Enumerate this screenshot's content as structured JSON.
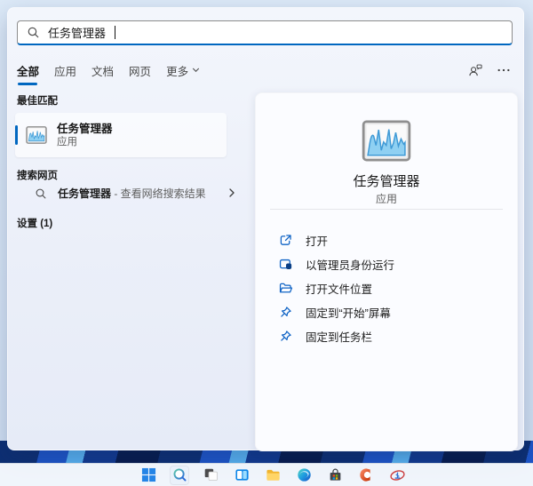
{
  "accent_color": "#0067c0",
  "search": {
    "value": "任务管理器",
    "icon": "search-icon"
  },
  "tabs": {
    "items": [
      {
        "label": "全部",
        "active": true
      },
      {
        "label": "应用",
        "active": false
      },
      {
        "label": "文档",
        "active": false
      },
      {
        "label": "网页",
        "active": false
      },
      {
        "label": "更多",
        "active": false,
        "has_chevron": true
      }
    ],
    "right_icons": [
      "account-icon",
      "ellipsis-icon"
    ]
  },
  "sections": {
    "best_match_label": "最佳匹配",
    "web_search_label": "搜索网页",
    "settings_label": "设置 (1)"
  },
  "best_match": {
    "title": "任务管理器",
    "subtitle": "应用",
    "icon": "task-manager-icon"
  },
  "web_item": {
    "title": "任务管理器",
    "suffix": " - 查看网络搜索结果",
    "icon": "search-icon",
    "chevron": "chevron-right-icon"
  },
  "preview": {
    "title": "任务管理器",
    "subtitle": "应用",
    "icon": "task-manager-icon",
    "actions": [
      {
        "label": "打开",
        "icon": "open-icon"
      },
      {
        "label": "以管理员身份运行",
        "icon": "run-as-admin-icon"
      },
      {
        "label": "打开文件位置",
        "icon": "open-file-location-icon"
      },
      {
        "label": "固定到“开始”屏幕",
        "icon": "pin-icon"
      },
      {
        "label": "固定到任务栏",
        "icon": "pin-icon"
      }
    ]
  },
  "taskbar": {
    "icons": [
      "windows-start",
      "search",
      "task-view",
      "widgets",
      "file-explorer",
      "edge-browser",
      "microsoft-store",
      "office",
      "unknown-app"
    ],
    "active_icon": "search"
  }
}
